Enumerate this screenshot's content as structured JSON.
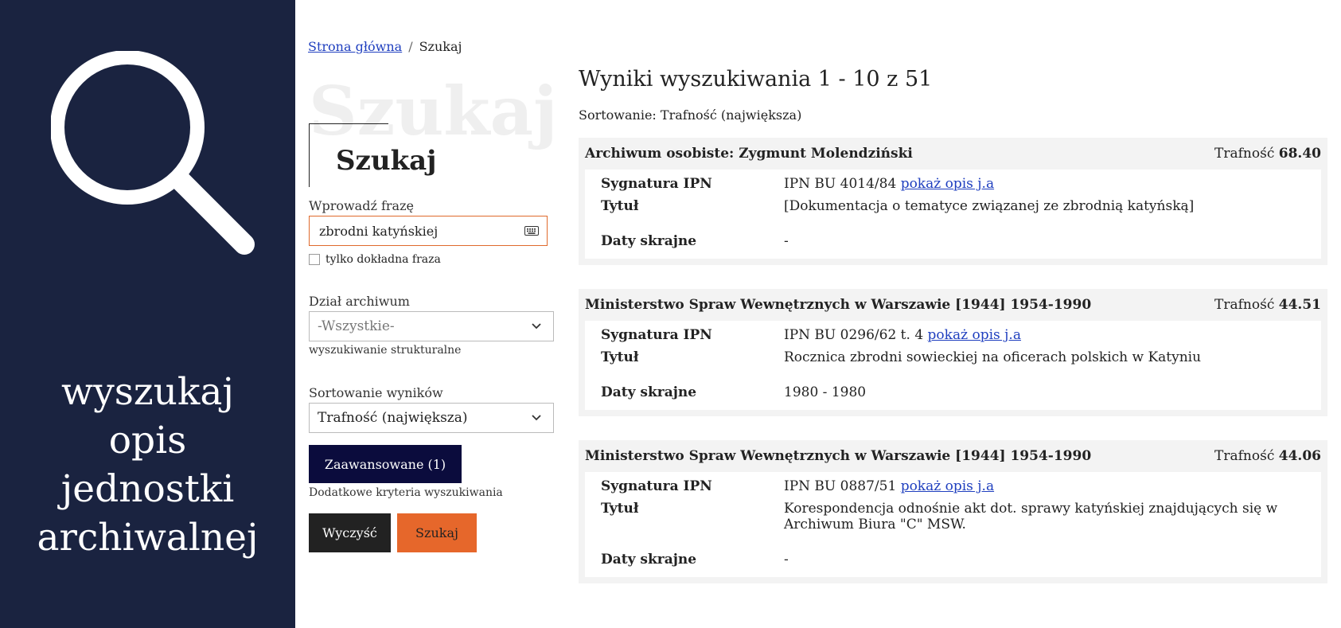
{
  "hero": {
    "icon": "search-icon",
    "line1": "wyszukaj",
    "line2": "opis",
    "line3": "jednostki",
    "line4": "archiwalnej"
  },
  "breadcrumb": {
    "home": "Strona główna",
    "separator": "/",
    "current": "Szukaj"
  },
  "form": {
    "ghost_title": "Szukaj",
    "title": "Szukaj",
    "phrase_label": "Wprowadź frazę",
    "phrase_value": "zbrodni katyńskiej",
    "keyboard_icon": "keyboard-icon",
    "exact_label": "tylko dokładna fraza",
    "section_label": "Dział archiwum",
    "section_value": "-Wszystkie-",
    "structural_label": "wyszukiwanie strukturalne",
    "sort_label": "Sortowanie wyników",
    "sort_value": "Trafność (największa)",
    "advanced_label": "Zaawansowane (1)",
    "advanced_hint": "Dodatkowe kryteria wyszukiwania",
    "clear_label": "Wyczyść",
    "search_label": "Szukaj",
    "accent_color": "#e6672b",
    "hero_color": "#1a2340"
  },
  "results": {
    "title": "Wyniki wyszukiwania 1 - 10 z 51",
    "sort_text": "Sortowanie: Trafność (największa)",
    "score_label": "Trafność",
    "signature_label": "Sygnatura IPN",
    "title_label": "Tytuł",
    "dates_label": "Daty skrajne",
    "link_label": "pokaż opis j.a",
    "items": [
      {
        "name": "Archiwum osobiste: Zygmunt Molendziński",
        "score": "68.40",
        "signature": "IPN BU 4014/84",
        "title": "[Dokumentacja o tematyce związanej ze zbrodnią katyńską]",
        "dates": "-"
      },
      {
        "name": "Ministerstwo Spraw Wewnętrznych w Warszawie [1944] 1954-1990",
        "score": "44.51",
        "signature": "IPN BU 0296/62 t. 4",
        "title": "Rocznica zbrodni sowieckiej na oficerach polskich w Katyniu",
        "dates": "1980 - 1980"
      },
      {
        "name": "Ministerstwo Spraw Wewnętrznych w Warszawie [1944] 1954-1990",
        "score": "44.06",
        "signature": "IPN BU 0887/51",
        "title": "Korespondencja odnośnie akt dot. sprawy katyńskiej znajdujących się w Archiwum Biura \"C\" MSW.",
        "dates": "-"
      }
    ]
  }
}
